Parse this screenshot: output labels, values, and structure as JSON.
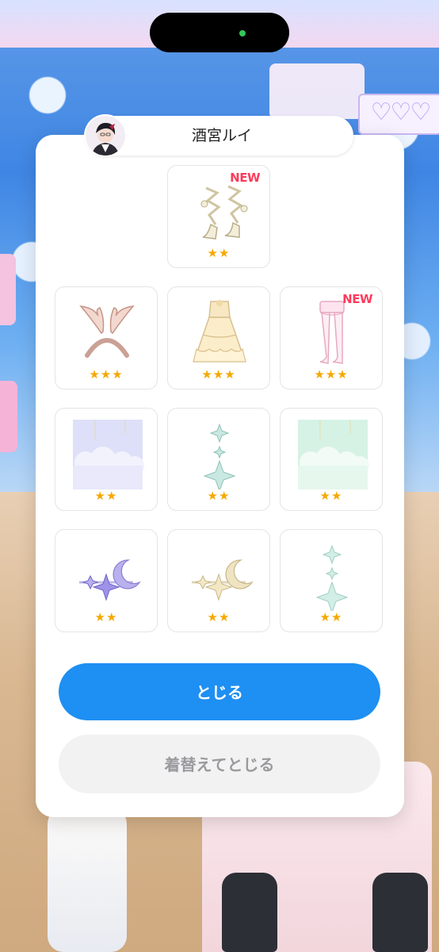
{
  "character": {
    "name": "酒宮ルイ",
    "avatar_icon": "character-avatar-icon"
  },
  "items": [
    {
      "icon": "ribbon-boots-icon",
      "stars": "★★",
      "badge": "NEW"
    },
    {
      "icon": "wing-headband-icon",
      "stars": "★★★",
      "badge": ""
    },
    {
      "icon": "frill-dress-icon",
      "stars": "★★★",
      "badge": ""
    },
    {
      "icon": "lace-stockings-icon",
      "stars": "★★★",
      "badge": "NEW"
    },
    {
      "icon": "cloud-wallpaper-purple-icon",
      "stars": "★★",
      "badge": ""
    },
    {
      "icon": "sparkle-earring-teal-icon",
      "stars": "★★",
      "badge": ""
    },
    {
      "icon": "cloud-wallpaper-mint-icon",
      "stars": "★★",
      "badge": ""
    },
    {
      "icon": "moon-star-hairpin-purple-icon",
      "stars": "★★",
      "badge": ""
    },
    {
      "icon": "moon-star-hairpin-gold-icon",
      "stars": "★★",
      "badge": ""
    },
    {
      "icon": "sparkle-earring-mint-icon",
      "stars": "★★",
      "badge": ""
    }
  ],
  "buttons": {
    "close_label": "とじる",
    "change_close_label": "着替えてとじる"
  },
  "colors": {
    "primary": "#1e8ff3",
    "star": "#f5a800",
    "new_badge": "#ff3b5c"
  }
}
